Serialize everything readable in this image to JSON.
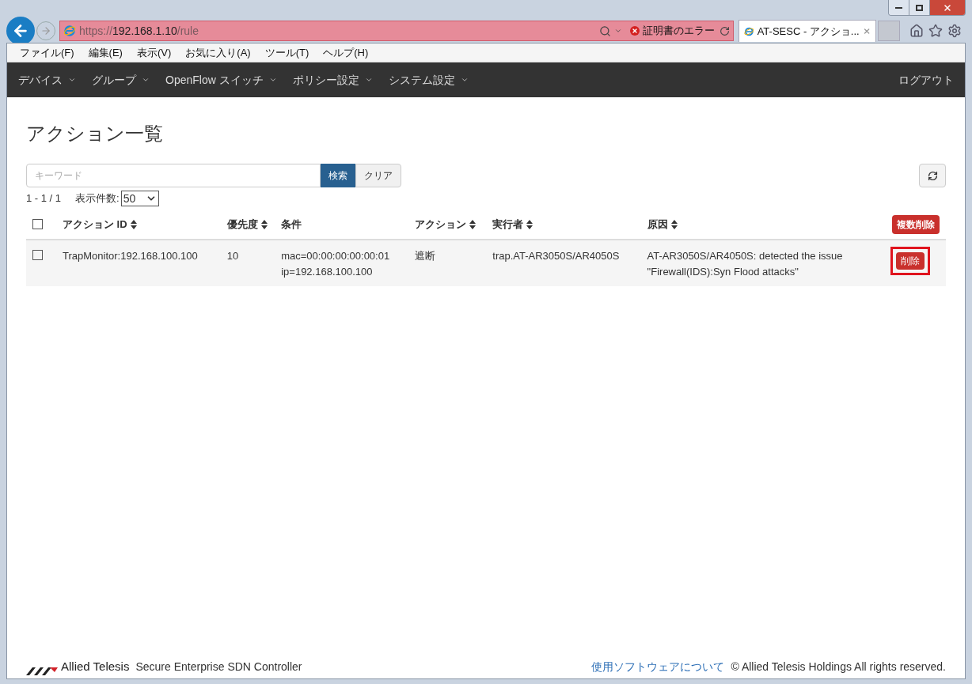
{
  "browser": {
    "address": {
      "scheme": "https://",
      "host": "192.168.1.10",
      "path": "/rule"
    },
    "cert_error": "証明書のエラー",
    "tab": {
      "title": "AT-SESC - アクショ...",
      "selected": true
    },
    "menu": [
      "ファイル(F)",
      "編集(E)",
      "表示(V)",
      "お気に入り(A)",
      "ツール(T)",
      "ヘルプ(H)"
    ]
  },
  "navbar": {
    "items": [
      "デバイス",
      "グループ",
      "OpenFlow スイッチ",
      "ポリシー設定",
      "システム設定"
    ],
    "logout": "ログアウト"
  },
  "page": {
    "title": "アクション一覧",
    "search": {
      "placeholder": "キーワード",
      "search_button": "検索",
      "clear_button": "クリア"
    },
    "range": "1 - 1 / 1",
    "page_size_label": "表示件数:",
    "page_size": "50"
  },
  "table": {
    "select_all_checked": false,
    "bulk_delete": "複数削除",
    "columns": [
      {
        "label": "アクション ID",
        "sortable": true
      },
      {
        "label": "優先度",
        "sortable": true
      },
      {
        "label": "条件",
        "sortable": false
      },
      {
        "label": "アクション",
        "sortable": true
      },
      {
        "label": "実行者",
        "sortable": true
      },
      {
        "label": "原因",
        "sortable": true
      }
    ],
    "rows": [
      {
        "checked": false,
        "cells": [
          [
            "TrapMonitor:192.168.100.100"
          ],
          [
            "10"
          ],
          [
            "mac=00:00:00:00:00:01",
            "ip=192.168.100.100"
          ],
          [
            "遮断"
          ],
          [
            "trap.AT-AR3050S/AR4050S"
          ],
          [
            "AT-AR3050S/AR4050S: detected the issue",
            "\"Firewall(IDS):Syn Flood attacks\""
          ]
        ],
        "delete": "削除",
        "delete_highlighted": true
      }
    ]
  },
  "footer": {
    "brand": "Allied Telesis",
    "product": "Secure Enterprise SDN Controller",
    "link": "使用ソフトウェアについて",
    "copyright": "© Allied Telesis Holdings All rights reserved."
  }
}
